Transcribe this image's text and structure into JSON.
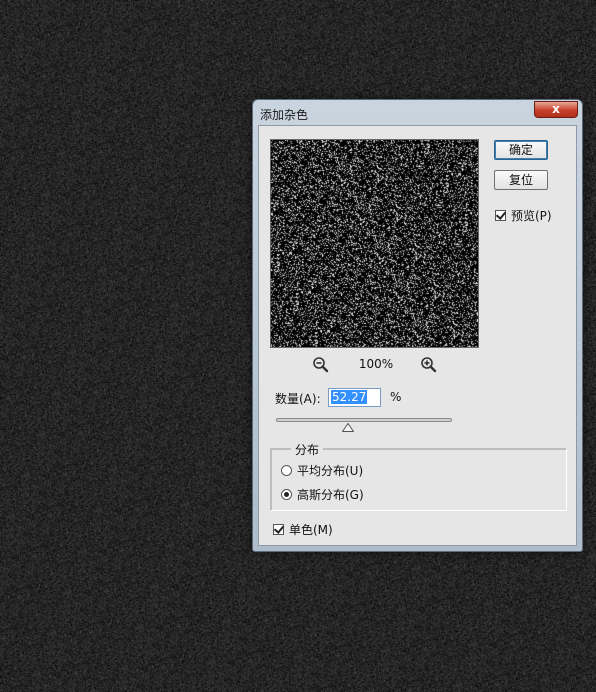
{
  "background": {
    "color": "#333333",
    "noise": "gaussian-gray"
  },
  "dialog": {
    "title": "添加杂色",
    "close_label": "x",
    "buttons": {
      "ok_label": "确定",
      "reset_label": "复位"
    },
    "preview_checkbox": {
      "label": "预览(P)",
      "checked": true
    },
    "preview": {
      "zoom_level": "100%",
      "zoom_out_icon": "zoom-out-icon",
      "zoom_in_icon": "zoom-in-icon"
    },
    "amount": {
      "label": "数量(A):",
      "value": "52.27",
      "unit": "%",
      "slider_fraction": 0.41
    },
    "distribution": {
      "legend": "分布",
      "options": [
        {
          "label": "平均分布(U)",
          "selected": false
        },
        {
          "label": "高斯分布(G)",
          "selected": true
        }
      ]
    },
    "monochromatic": {
      "label": "单色(M)",
      "checked": true
    },
    "colors": {
      "ok_outline": "#3c7fb1",
      "close": "#c8412a",
      "selection": "#3390ff"
    }
  }
}
